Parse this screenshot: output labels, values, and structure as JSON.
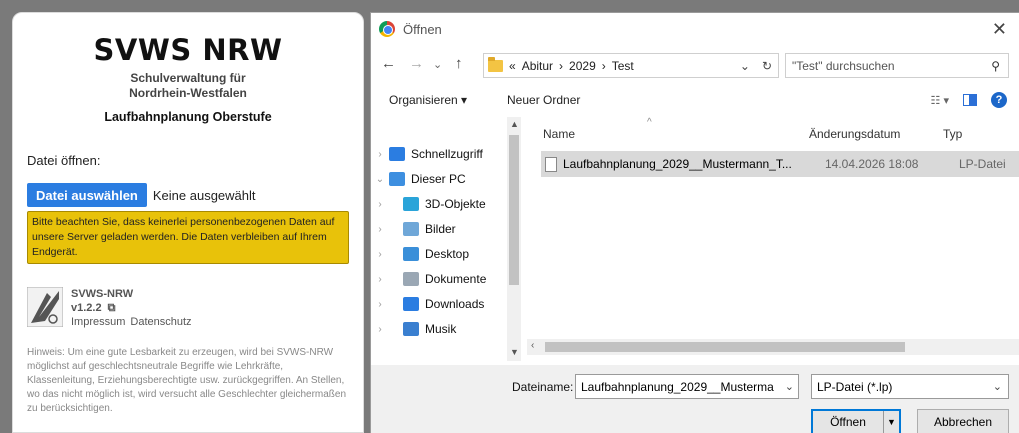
{
  "app": {
    "title": "SVWS NRW",
    "subtitle_line1": "Schulverwaltung für",
    "subtitle_line2": "Nordrhein-Westfalen",
    "module": "Laufbahnplanung Oberstufe",
    "open_label": "Datei öffnen:",
    "choose_file_button": "Datei auswählen",
    "file_status": "Keine ausgewählt",
    "privacy_note": "Bitte beachten Sie, dass keinerlei personenbezogenen Daten auf unsere Server geladen werden. Die Daten verbleiben auf Ihrem Endgerät.",
    "org_name": "SVWS-NRW",
    "version": "v1.2.2",
    "imprint_link": "Impressum",
    "privacy_link": "Datenschutz",
    "hint": "Hinweis: Um eine gute Lesbarkeit zu erzeugen, wird bei SVWS-NRW möglichst auf geschlechtsneutrale Begriffe wie Lehrkräfte, Klassenleitung, Erziehungsberechtigte usw. zurückgegriffen. An Stellen, wo das nicht möglich ist, wird versucht alle Geschlechter gleichermaßen zu berücksichtigen."
  },
  "dialog": {
    "title": "Öffnen",
    "breadcrumb": [
      "«",
      "Abitur",
      "›",
      "2029",
      "›",
      "Test"
    ],
    "search_placeholder": "\"Test\" durchsuchen",
    "toolbar": {
      "organize": "Organisieren ▾",
      "new_folder": "Neuer Ordner"
    },
    "nav_items": [
      {
        "label": "Schnellzugriff",
        "color": "#2b7de1",
        "chev": "›"
      },
      {
        "label": "Dieser PC",
        "color": "#3d8fe0",
        "chev": "⌄"
      },
      {
        "label": "3D-Objekte",
        "color": "#2aa4d9",
        "chev": "›"
      },
      {
        "label": "Bilder",
        "color": "#6fa7d8",
        "chev": "›"
      },
      {
        "label": "Desktop",
        "color": "#3a8fd9",
        "chev": "›"
      },
      {
        "label": "Dokumente",
        "color": "#9aa7b4",
        "chev": "›"
      },
      {
        "label": "Downloads",
        "color": "#2b7de1",
        "chev": "›"
      },
      {
        "label": "Musik",
        "color": "#3a7fd0",
        "chev": "›"
      }
    ],
    "columns": {
      "name": "Name",
      "modified": "Änderungsdatum",
      "type": "Typ"
    },
    "file": {
      "name": "Laufbahnplanung_2029__Mustermann_T...",
      "modified": "14.04.2026 18:08",
      "type": "LP-Datei"
    },
    "filename_label": "Dateiname:",
    "filename_value": "Laufbahnplanung_2029__Musterma",
    "filetype_value": "LP-Datei (*.lp)",
    "open_button": "Öffnen",
    "cancel_button": "Abbrechen"
  }
}
